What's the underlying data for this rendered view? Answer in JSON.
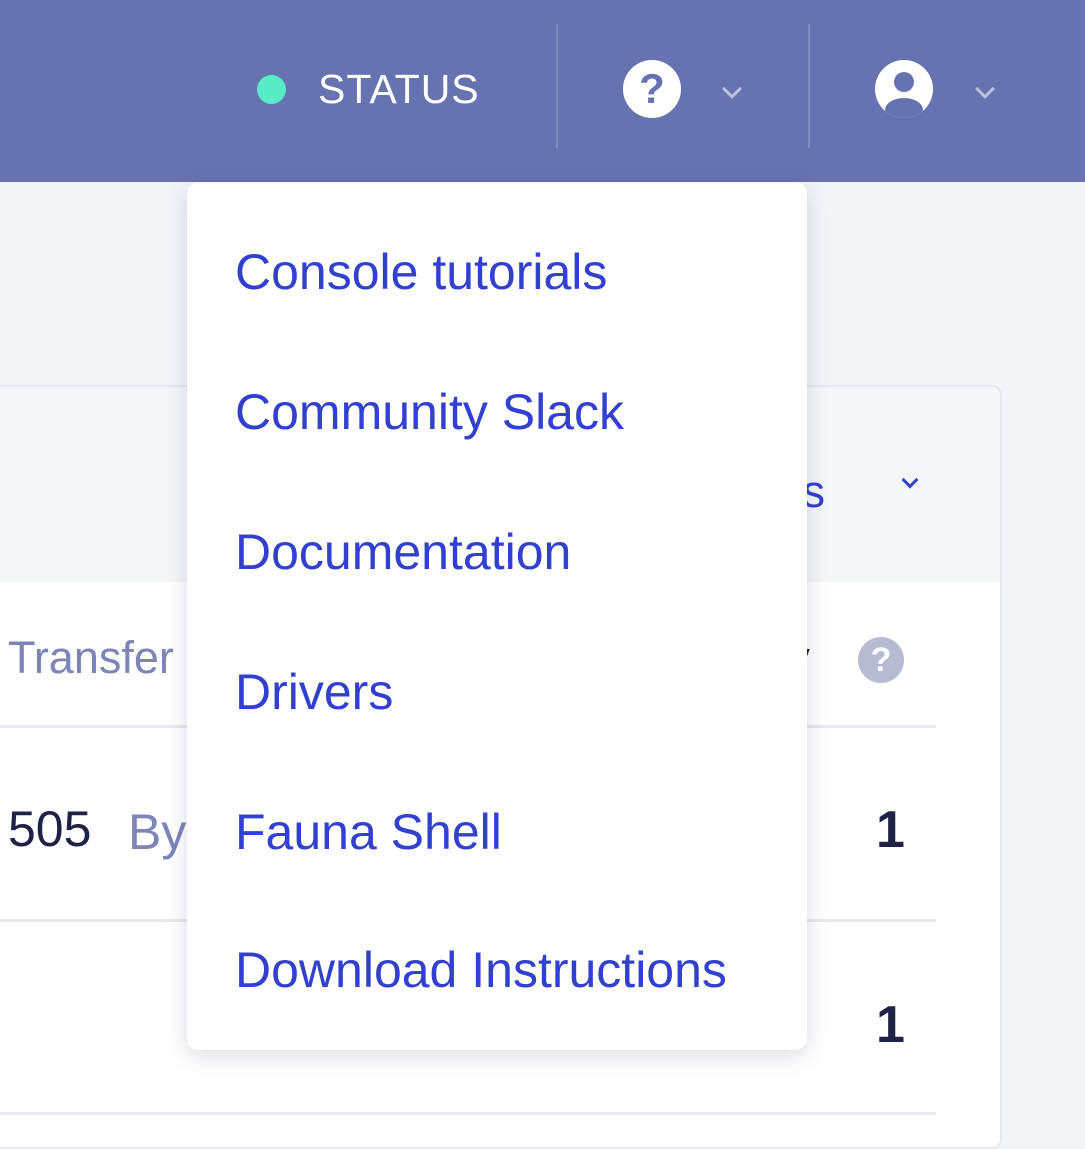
{
  "topbar": {
    "status_label": "STATUS",
    "status_color": "#58ecc6",
    "background_color": "#6673b0",
    "help_icon": "question-circle-icon",
    "account_icon": "user-circle-icon",
    "dropdown_icon": "chevron-down-icon"
  },
  "help_menu": {
    "items": [
      {
        "label": "Console tutorials"
      },
      {
        "label": "Community Slack"
      },
      {
        "label": "Documentation"
      },
      {
        "label": "Drivers"
      },
      {
        "label": "Fauna Shell"
      },
      {
        "label": "Download Instructions"
      }
    ],
    "link_color": "#3240d0"
  },
  "usage_card": {
    "period_label_partial": "ays",
    "columns": {
      "left_partial": "Transfer",
      "right_partial": "ty",
      "info_glyph": "?"
    },
    "rows": [
      {
        "value": "505",
        "unit_partial": "By",
        "count": "1"
      },
      {
        "value": "",
        "unit_partial": "",
        "count": "1"
      }
    ]
  }
}
